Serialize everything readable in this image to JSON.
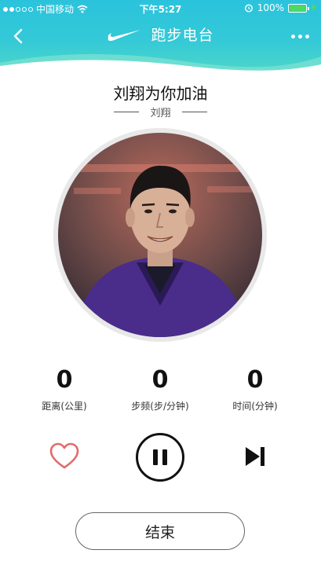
{
  "status_bar": {
    "carrier": "中国移动",
    "time": "下午5:27",
    "battery": "100%",
    "signal_filled": 2,
    "signal_total": 5
  },
  "navbar": {
    "title": "跑步电台",
    "back_icon": "chevron-left-icon",
    "logo": "nike-swoosh",
    "more_icon": "more-dots-icon"
  },
  "track": {
    "title": "刘翔为你加油",
    "artist": "刘翔"
  },
  "stats": [
    {
      "value": "0",
      "label": "距离(公里)"
    },
    {
      "value": "0",
      "label": "步频(步/分钟)"
    },
    {
      "value": "0",
      "label": "时间(分钟)"
    }
  ],
  "controls": {
    "like_icon": "heart-icon",
    "pause_icon": "pause-icon",
    "next_icon": "skip-next-icon"
  },
  "end_button": "结束",
  "colors": {
    "header_gradient_top": "#2bc3dc",
    "header_gradient_bottom": "#4dd6c8",
    "heart": "#e46a6a",
    "battery_fill": "#4cd964"
  }
}
